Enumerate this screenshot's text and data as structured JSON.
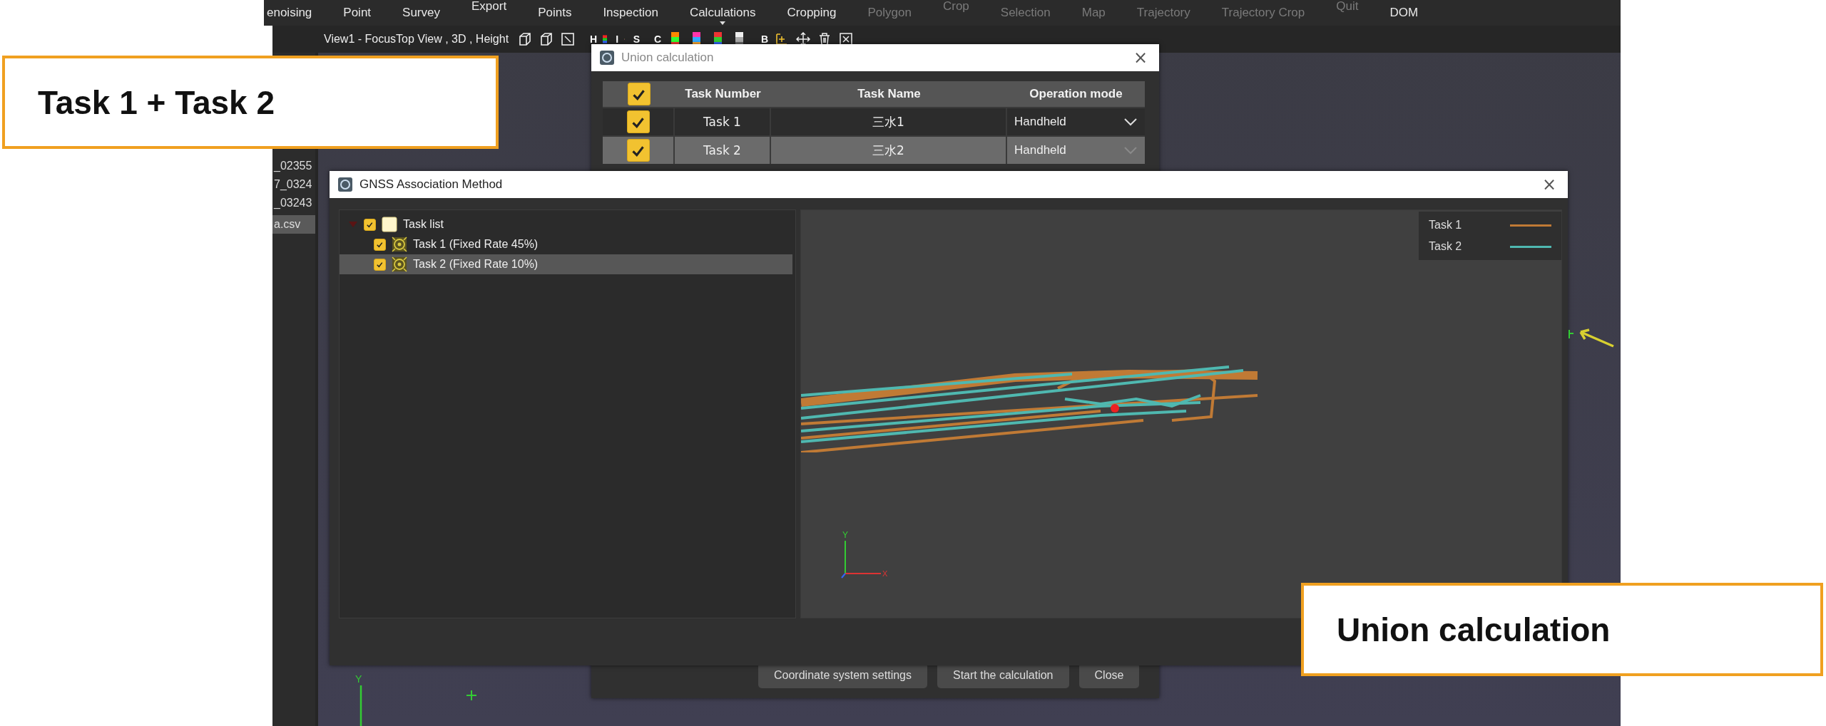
{
  "menu_bar": [
    {
      "label": "enoising",
      "disabled": false,
      "raised": false
    },
    {
      "label": "Point",
      "disabled": false,
      "raised": false
    },
    {
      "label": "Survey",
      "disabled": false,
      "raised": false
    },
    {
      "label": "Export",
      "disabled": false,
      "raised": true
    },
    {
      "label": "Points",
      "disabled": false,
      "raised": false
    },
    {
      "label": "Inspection",
      "disabled": false,
      "raised": false
    },
    {
      "label": "Calculations",
      "disabled": false,
      "raised": false,
      "dropdown": true
    },
    {
      "label": "Cropping",
      "disabled": false,
      "raised": false
    },
    {
      "label": "Polygon",
      "disabled": true,
      "raised": false
    },
    {
      "label": "Crop",
      "disabled": true,
      "raised": true
    },
    {
      "label": "Selection",
      "disabled": true,
      "raised": false
    },
    {
      "label": "Map",
      "disabled": true,
      "raised": false
    },
    {
      "label": "Trajectory",
      "disabled": true,
      "raised": false
    },
    {
      "label": "Trajectory Crop",
      "disabled": true,
      "raised": false
    },
    {
      "label": "Quit",
      "disabled": true,
      "raised": true
    },
    {
      "label": "DOM",
      "disabled": false,
      "raised": false
    }
  ],
  "view_tab": {
    "label": "View1 - FocusTop View , 3D , Height"
  },
  "toolbar": [
    {
      "kind": "cube"
    },
    {
      "kind": "cube"
    },
    {
      "kind": "frame"
    },
    {
      "kind": "color",
      "label": "H"
    },
    {
      "kind": "color",
      "label": "I"
    },
    {
      "kind": "color",
      "label": "S"
    },
    {
      "kind": "color",
      "label": "C"
    },
    {
      "kind": "color"
    },
    {
      "kind": "color"
    },
    {
      "kind": "color"
    },
    {
      "kind": "color"
    },
    {
      "kind": "color",
      "label": "B"
    },
    {
      "kind": "add"
    },
    {
      "kind": "move"
    },
    {
      "kind": "trash"
    },
    {
      "kind": "clear"
    }
  ],
  "sidebar": {
    "items": [
      {
        "label": "_02355",
        "selected": false
      },
      {
        "label": "7_0324",
        "selected": false
      },
      {
        "label": "_03243",
        "selected": false
      },
      {
        "label": "a.csv",
        "selected": true
      }
    ]
  },
  "viewport": {
    "axis_label": "Y"
  },
  "union_dialog": {
    "title": "Union calculation",
    "close_label": "×",
    "table": {
      "header_checked": true,
      "columns": [
        "Task Number",
        "Task Name",
        "Operation mode"
      ],
      "rows": [
        {
          "checked": true,
          "selected": false,
          "number": "Task 1",
          "name": "三水1",
          "mode": "Handheld"
        },
        {
          "checked": true,
          "selected": true,
          "number": "Task 2",
          "name": "三水2",
          "mode": "Handheld"
        }
      ]
    },
    "buttons": [
      "Coordinate system settings",
      "Start the calculation",
      "Close"
    ]
  },
  "gnss_window": {
    "title": "GNSS Association Method",
    "close_label": "×",
    "tree": [
      {
        "label": "Task list",
        "checked": true,
        "expanded": true,
        "selected": false,
        "kind": "folder",
        "children": [
          {
            "label": "Task 1 (Fixed Rate 45%)",
            "checked": true,
            "selected": false,
            "kind": "task"
          },
          {
            "label": "Task 2 (Fixed Rate 10%)",
            "checked": true,
            "selected": true,
            "kind": "task"
          }
        ]
      }
    ],
    "legend": [
      {
        "name": "Task 1",
        "color": "#c07a35"
      },
      {
        "name": "Task 2",
        "color": "#4fb8b0"
      }
    ],
    "axis_labels": [
      "Y",
      "X"
    ]
  },
  "callouts": [
    {
      "text": "Task 1 + Task 2"
    },
    {
      "text": "Union calculation"
    }
  ]
}
